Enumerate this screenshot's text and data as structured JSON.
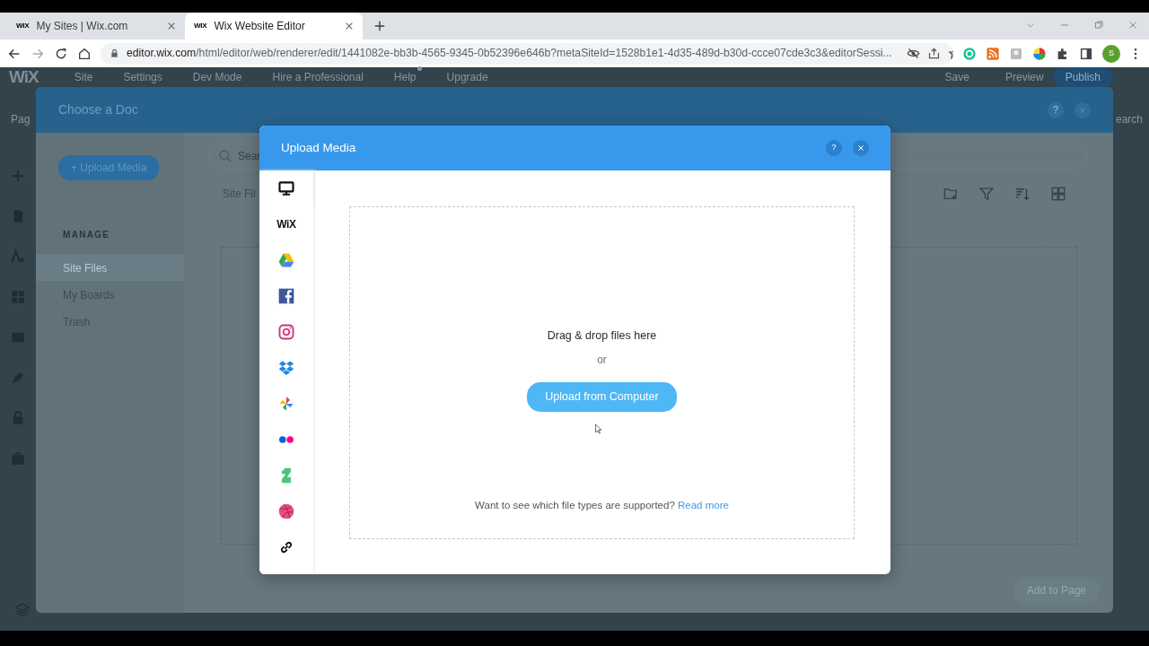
{
  "browser": {
    "tabs": [
      {
        "favicon": "WIX",
        "title": "My Sites | Wix.com",
        "selected": false
      },
      {
        "favicon": "WIX",
        "title": "Wix Website Editor",
        "selected": true
      }
    ],
    "url_host": "editor.wix.com",
    "url_path": "/html/editor/web/renderer/edit/1441082e-bb3b-4565-9345-0b52396e646b?metaSiteId=1528b1e1-4d35-489d-b30d-ccce07cde3c3&editorSessi...",
    "avatar": "S"
  },
  "editor": {
    "logo": "WiX",
    "menu": [
      {
        "label": "Site",
        "dot": false
      },
      {
        "label": "Settings",
        "dot": false
      },
      {
        "label": "Dev Mode",
        "dot": false
      },
      {
        "label": "Hire a Professional",
        "dot": false
      },
      {
        "label": "Help",
        "dot": true
      },
      {
        "label": "Upgrade",
        "dot": false
      }
    ],
    "actions": [
      "Save",
      "Preview"
    ],
    "publish": "Publish",
    "pages_label": "Pag",
    "search_label": "earch"
  },
  "choose_doc": {
    "title": "Choose a Doc",
    "upload_button": "+ Upload Media",
    "section": "MANAGE",
    "items": [
      {
        "label": "Site Files",
        "selected": true
      },
      {
        "label": "My Boards",
        "selected": false
      },
      {
        "label": "Trash",
        "selected": false
      }
    ],
    "search_placeholder": "Sear",
    "breadcrumb": "Site Fil",
    "add_button": {
      "label": "Add to Page",
      "disabled": true
    }
  },
  "upload_media": {
    "title": "Upload Media",
    "help": "?",
    "sources": [
      {
        "kind": "computer",
        "selected": true
      },
      {
        "kind": "wix",
        "label": "WiX",
        "selected": false
      },
      {
        "kind": "drive",
        "selected": false
      },
      {
        "kind": "facebook",
        "selected": false
      },
      {
        "kind": "instagram",
        "selected": false
      },
      {
        "kind": "dropbox",
        "selected": false
      },
      {
        "kind": "photos",
        "selected": false
      },
      {
        "kind": "flickr",
        "selected": false
      },
      {
        "kind": "deviantart",
        "selected": false
      },
      {
        "kind": "dribbble",
        "selected": false
      },
      {
        "kind": "link",
        "selected": false
      }
    ],
    "drop_text": "Drag & drop files here",
    "or": "or",
    "upload_button": "Upload from Computer",
    "footer_text": "Want to see which file types are supported?",
    "footer_link": "Read more"
  }
}
